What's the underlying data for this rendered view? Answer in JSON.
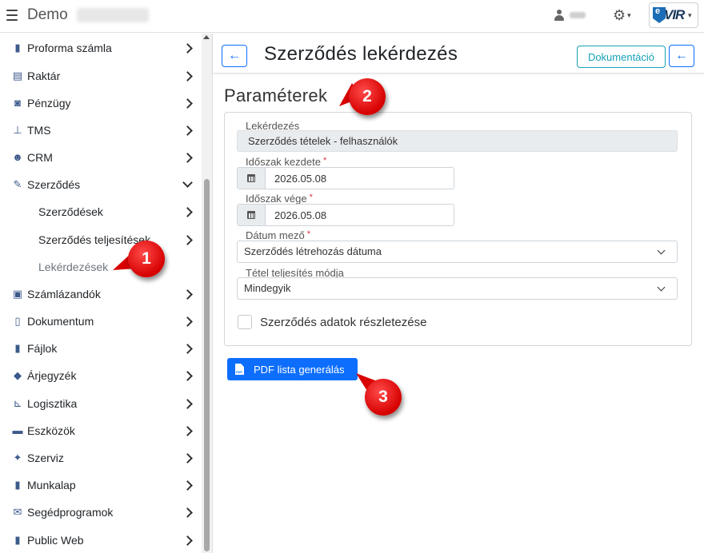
{
  "topbar": {
    "brand": "Demo",
    "icons": {
      "menu": "hamburger-icon",
      "user": "user-icon",
      "settings": "gear-icon"
    },
    "settings_glyph": "⚙",
    "caret": "▾",
    "logo": {
      "e": "e",
      "text": "VIR"
    }
  },
  "sidebar": {
    "items": [
      {
        "label": "Proforma számla",
        "icon": "proforma-icon",
        "glyph": "▮"
      },
      {
        "label": "Raktár",
        "icon": "warehouse-icon",
        "glyph": "▤"
      },
      {
        "label": "Pénzügy",
        "icon": "money-icon",
        "glyph": "◙"
      },
      {
        "label": "TMS",
        "icon": "pin-icon",
        "glyph": "⊥"
      },
      {
        "label": "CRM",
        "icon": "users-icon",
        "glyph": "☻"
      },
      {
        "label": "Szerződés",
        "icon": "contract-icon",
        "glyph": "✎"
      },
      {
        "label": "Szerződések",
        "icon": ""
      },
      {
        "label": "Szerződés teljesítések",
        "icon": ""
      },
      {
        "label": "Lekérdezések",
        "icon": ""
      },
      {
        "label": "Számlázandók",
        "icon": "copy-icon",
        "glyph": "▣"
      },
      {
        "label": "Dokumentum",
        "icon": "document-icon",
        "glyph": "▯"
      },
      {
        "label": "Fájlok",
        "icon": "file-icon",
        "glyph": "▮"
      },
      {
        "label": "Árjegyzék",
        "icon": "tags-icon",
        "glyph": "◆"
      },
      {
        "label": "Logisztika",
        "icon": "dolly-icon",
        "glyph": "⊾"
      },
      {
        "label": "Eszközök",
        "icon": "toolbox-icon",
        "glyph": "▬"
      },
      {
        "label": "Szerviz",
        "icon": "wrench-icon",
        "glyph": "✦"
      },
      {
        "label": "Munkalap",
        "icon": "book-icon",
        "glyph": "▮"
      },
      {
        "label": "Segédprogramok",
        "icon": "envelope-icon",
        "glyph": "✉"
      },
      {
        "label": "Public Web",
        "icon": "globe-icon",
        "glyph": "▮"
      }
    ]
  },
  "header": {
    "back_glyph": "←",
    "title": "Szerződés lekérdezés",
    "doc_button": "Dokumentáció"
  },
  "form": {
    "section_title": "Paraméterek",
    "query_label": "Lekérdezés",
    "query_value": "Szerződés tételek - felhasználók",
    "start_label": "Időszak kezdete",
    "start_value": "2026.05.08",
    "end_label": "Időszak vége",
    "end_value": "2026.05.08",
    "date_field_label": "Dátum mező",
    "date_field_value": "Szerződés létrehozás dátuma",
    "mode_label": "Tétel teljesítés módja",
    "mode_value": "Mindegyik",
    "required_mark": "*",
    "details_checkbox": "Szerződés adatok részletezése",
    "details_checked": false
  },
  "actions": {
    "pdf_button": "PDF lista generálás"
  },
  "callouts": [
    "1",
    "2",
    "3"
  ],
  "colors": {
    "primary": "#0d6efd",
    "info": "#17a2b8",
    "danger": "#dc3545",
    "callout": "#e00000"
  }
}
